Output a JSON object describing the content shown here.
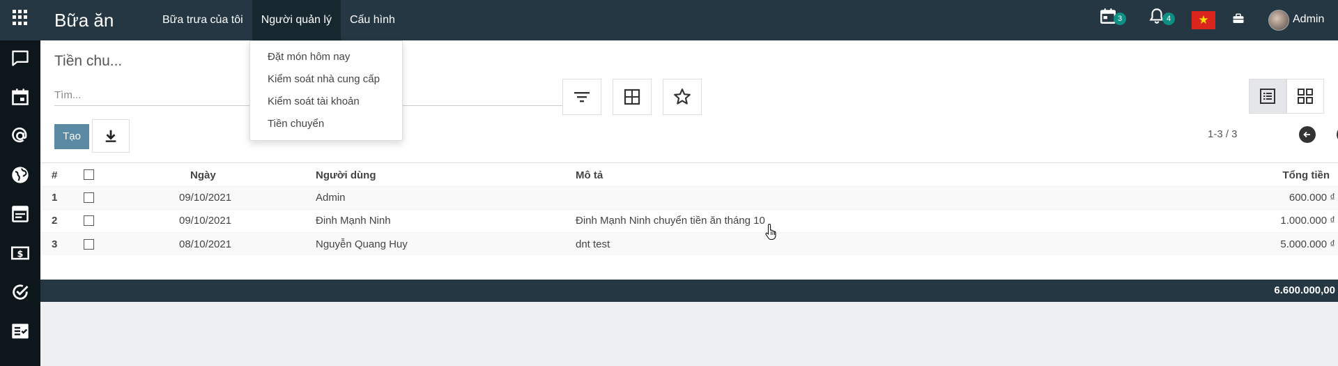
{
  "app": {
    "title": "Bữa ăn"
  },
  "topmenu": {
    "items": [
      {
        "label": "Bữa trưa của tôi"
      },
      {
        "label": "Người quản lý"
      },
      {
        "label": "Cấu hình"
      }
    ]
  },
  "systray": {
    "activities_count": "3",
    "notifications_count": "4",
    "user_name": "Admin"
  },
  "sidebar": {
    "icons": [
      "chat-icon",
      "calendar-icon",
      "at-sign-icon",
      "globe-icon",
      "article-icon",
      "dollar-icon",
      "check-circle-icon",
      "checklist-icon"
    ]
  },
  "control_panel": {
    "breadcrumb": "Tiền chu...",
    "search_placeholder": "Tìm...",
    "create_label": "Tạo",
    "pager": "1-3 / 3"
  },
  "table": {
    "headers": {
      "index": "#",
      "date": "Ngày",
      "user": "Người dùng",
      "description": "Mô tả",
      "amount": "Tổng tiền"
    },
    "rows": [
      {
        "index": "1",
        "date": "09/10/2021",
        "user": "Admin",
        "description": "",
        "amount": "600.000 ₫"
      },
      {
        "index": "2",
        "date": "09/10/2021",
        "user": "Đinh Mạnh Ninh",
        "description": "Đinh Mạnh Ninh chuyển tiền ăn tháng 10",
        "amount": "1.000.000 ₫"
      },
      {
        "index": "3",
        "date": "08/10/2021",
        "user": "Nguyễn Quang Huy",
        "description": "dnt test",
        "amount": "5.000.000 ₫"
      }
    ],
    "total": "6.600.000,00"
  },
  "dropdown": {
    "items": [
      {
        "label": "Đặt món hôm nay"
      },
      {
        "label": "Kiểm soát nhà cung cấp"
      },
      {
        "label": "Kiểm soát tài khoản"
      },
      {
        "label": "Tiền chuyển"
      }
    ]
  },
  "colors": {
    "navbar": "#243742",
    "sidebar": "#0d161b",
    "primary_button": "#5a8aa3",
    "badge": "#0e8f84"
  }
}
